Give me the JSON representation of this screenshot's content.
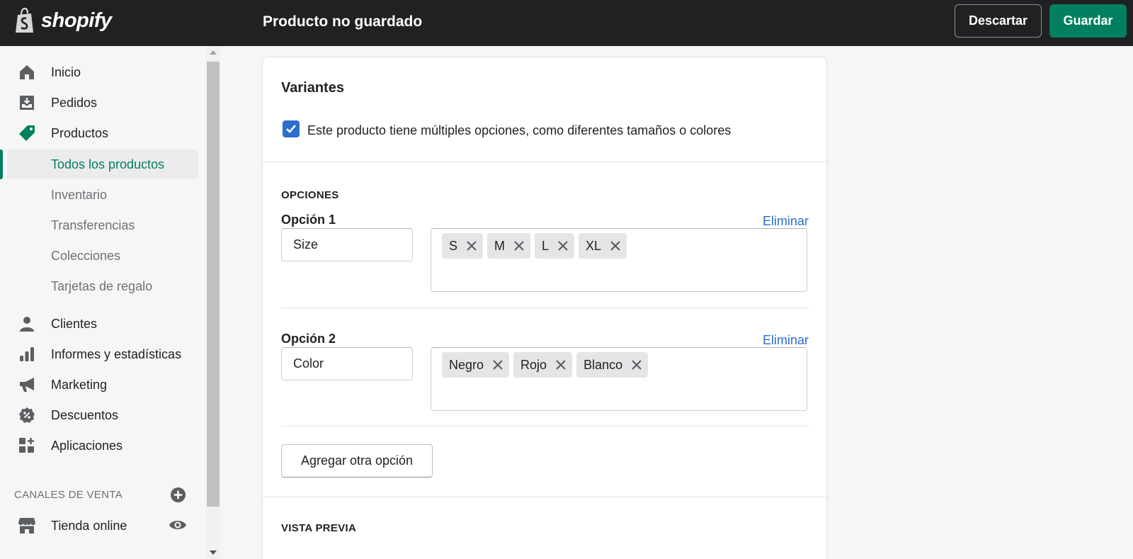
{
  "topbar": {
    "logo_text": "shopify",
    "title": "Producto no guardado",
    "discard_label": "Descartar",
    "save_label": "Guardar"
  },
  "sidebar": {
    "main_items": [
      {
        "label": "Inicio",
        "icon": "home-icon"
      },
      {
        "label": "Pedidos",
        "icon": "orders-icon"
      },
      {
        "label": "Productos",
        "icon": "tag-icon"
      }
    ],
    "sub_items": [
      {
        "label": "Todos los productos",
        "active": true
      },
      {
        "label": "Inventario"
      },
      {
        "label": "Transferencias"
      },
      {
        "label": "Colecciones"
      },
      {
        "label": "Tarjetas de regalo"
      }
    ],
    "lower_items": [
      {
        "label": "Clientes",
        "icon": "customer-icon"
      },
      {
        "label": "Informes y estadísticas",
        "icon": "analytics-icon"
      },
      {
        "label": "Marketing",
        "icon": "megaphone-icon"
      },
      {
        "label": "Descuentos",
        "icon": "discount-icon"
      },
      {
        "label": "Aplicaciones",
        "icon": "apps-icon"
      }
    ],
    "channels_title": "CANALES DE VENTA",
    "channel": {
      "label": "Tienda online",
      "icon": "store-icon"
    }
  },
  "variants": {
    "title": "Variantes",
    "checkbox_label": "Este producto tiene múltiples opciones, como diferentes tamaños o colores",
    "checked": true,
    "options_heading": "OPCIONES",
    "options": [
      {
        "label": "Opción 1",
        "remove": "Eliminar",
        "name": "Size",
        "values": [
          "S",
          "M",
          "L",
          "XL"
        ]
      },
      {
        "label": "Opción 2",
        "remove": "Eliminar",
        "name": "Color",
        "values": [
          "Negro",
          "Rojo",
          "Blanco"
        ]
      }
    ],
    "add_option_label": "Agregar otra opción",
    "preview_heading": "VISTA PREVIA"
  },
  "colors": {
    "primary": "#008060",
    "link": "#2c6ecb",
    "topbar": "#202123"
  }
}
